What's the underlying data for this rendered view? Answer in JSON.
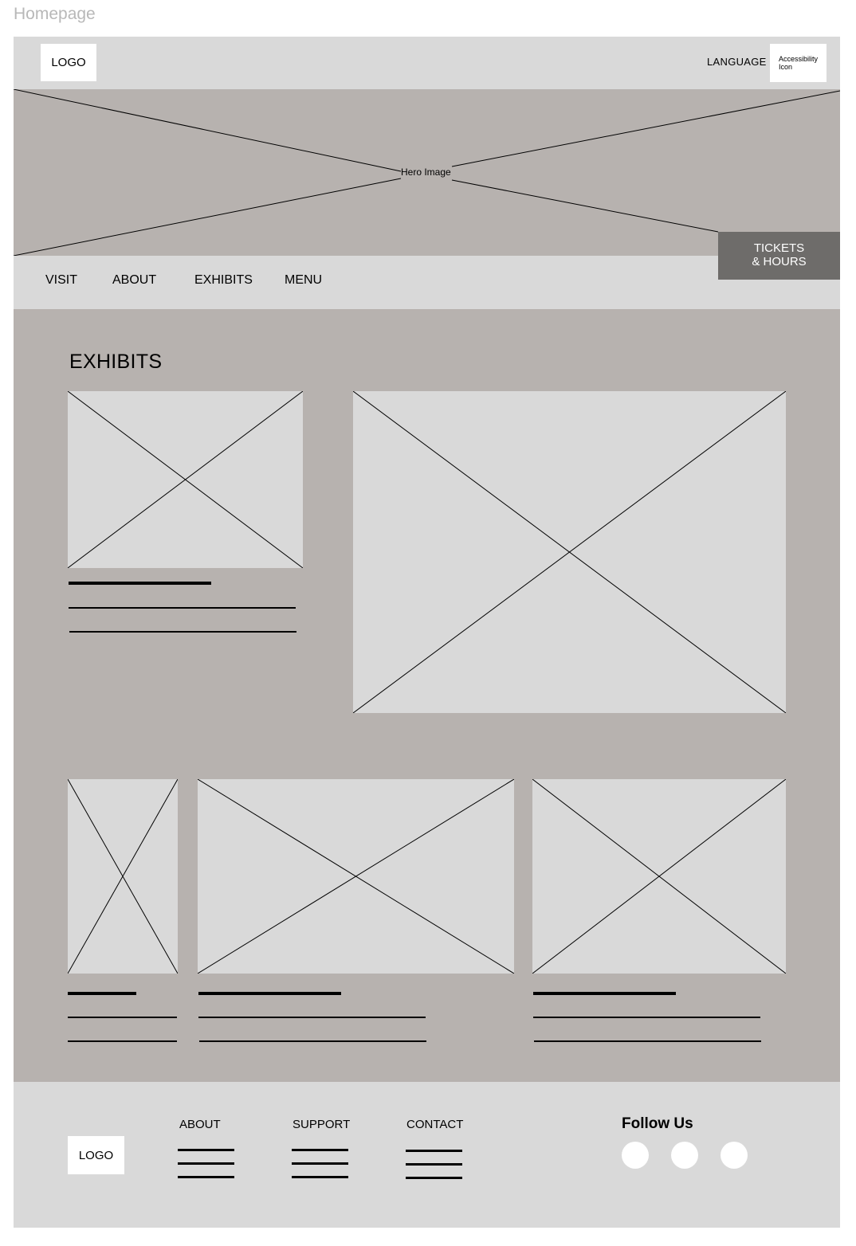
{
  "frame_label": "Homepage",
  "header": {
    "logo": "LOGO",
    "language": "LANGUAGE",
    "accessibility_line1": "Accessibility",
    "accessibility_line2": "Icon"
  },
  "hero": {
    "label": "Hero Image"
  },
  "tickets": {
    "line1": "TICKETS",
    "line2": "& HOURS"
  },
  "nav": {
    "items": [
      "VISIT",
      "ABOUT",
      "EXHIBITS",
      "MENU"
    ]
  },
  "exhibits": {
    "title": "EXHIBITS"
  },
  "footer": {
    "logo": "LOGO",
    "columns": [
      "ABOUT",
      "SUPPORT",
      "CONTACT"
    ],
    "follow": "Follow Us",
    "social_icons": [
      "social-icon",
      "social-icon",
      "social-icon"
    ]
  },
  "colors": {
    "frame_bg": "#d9d9d9",
    "section_bg": "#b7b2af",
    "tickets_bg": "#6e6c6a"
  }
}
